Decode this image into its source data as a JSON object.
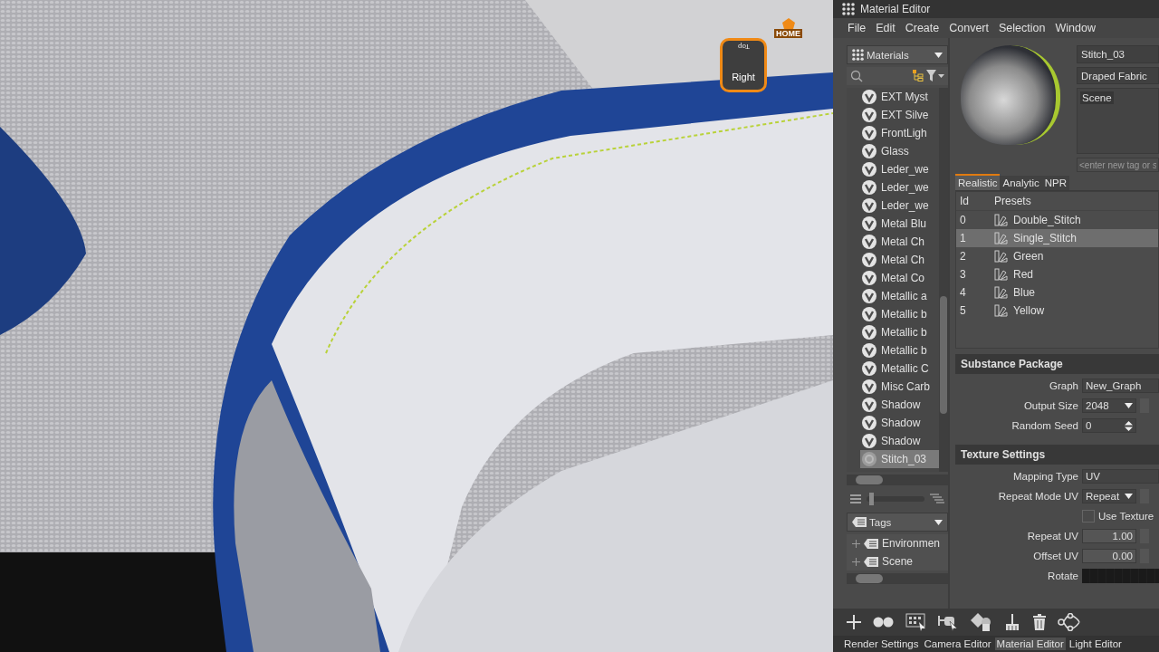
{
  "window": {
    "title": "Material Editor"
  },
  "menu": [
    "File",
    "Edit",
    "Create",
    "Convert",
    "Selection",
    "Window"
  ],
  "viewcube": {
    "top": "Top",
    "side": "Right",
    "home": "HOME"
  },
  "material_browser": {
    "dropdown": "Materials",
    "materials": [
      {
        "name": "EXT Myst",
        "selected": false
      },
      {
        "name": "EXT Silve",
        "selected": false
      },
      {
        "name": "FrontLigh",
        "selected": false
      },
      {
        "name": "Glass",
        "selected": false
      },
      {
        "name": "Leder_we",
        "selected": false
      },
      {
        "name": "Leder_we",
        "selected": false
      },
      {
        "name": "Leder_we",
        "selected": false
      },
      {
        "name": "Metal Blu",
        "selected": false
      },
      {
        "name": "Metal Ch",
        "selected": false
      },
      {
        "name": "Metal Ch",
        "selected": false
      },
      {
        "name": "Metal Co",
        "selected": false
      },
      {
        "name": "Metallic a",
        "selected": false
      },
      {
        "name": "Metallic b",
        "selected": false
      },
      {
        "name": "Metallic b",
        "selected": false
      },
      {
        "name": "Metallic b",
        "selected": false
      },
      {
        "name": "Metallic C",
        "selected": false
      },
      {
        "name": "Misc Carb",
        "selected": false
      },
      {
        "name": "Shadow",
        "selected": false
      },
      {
        "name": "Shadow",
        "selected": false
      },
      {
        "name": "Shadow",
        "selected": false
      },
      {
        "name": "Stitch_03",
        "selected": true
      }
    ]
  },
  "icon_size": {
    "level": 0.05
  },
  "tags_browser": {
    "dropdown": "Tags",
    "tags": [
      "Environmen",
      "Scene"
    ]
  },
  "material": {
    "name": "Stitch_03",
    "type": "Draped Fabric",
    "tags": [
      "Scene"
    ],
    "tag_placeholder": "<enter new tag or s"
  },
  "tabs": [
    {
      "label": "Realistic",
      "selected": true
    },
    {
      "label": "Analytic",
      "selected": false
    },
    {
      "label": "NPR",
      "selected": false
    }
  ],
  "presets": {
    "columns": [
      "Id",
      "Presets"
    ],
    "rows": [
      {
        "id": "0",
        "name": "Double_Stitch",
        "selected": false
      },
      {
        "id": "1",
        "name": "Single_Stitch",
        "selected": true
      },
      {
        "id": "2",
        "name": "Green",
        "selected": false
      },
      {
        "id": "3",
        "name": "Red",
        "selected": false
      },
      {
        "id": "4",
        "name": "Blue",
        "selected": false
      },
      {
        "id": "5",
        "name": "Yellow",
        "selected": false
      }
    ]
  },
  "sections": [
    {
      "title": "Substance Package",
      "fields": [
        {
          "kind": "text",
          "label": "Graph",
          "value": "New_Graph"
        },
        {
          "kind": "dropdown",
          "label": "Output Size",
          "value": "2048"
        },
        {
          "kind": "spinner",
          "label": "Random Seed",
          "value": "0"
        }
      ]
    },
    {
      "title": "Texture Settings",
      "fields": [
        {
          "kind": "text",
          "label": "Mapping Type",
          "value": "UV"
        },
        {
          "kind": "dropdown",
          "label": "Repeat Mode UV",
          "value": "Repeat"
        },
        {
          "kind": "checkbox",
          "label": "Use Texture",
          "checked": false
        },
        {
          "kind": "number",
          "label": "Repeat UV",
          "value": "1.00"
        },
        {
          "kind": "number",
          "label": "Offset UV",
          "value": "0.00"
        },
        {
          "kind": "ramp",
          "label": "Rotate"
        }
      ]
    }
  ],
  "bottom_tabs": [
    {
      "label": "Render Settings",
      "selected": false
    },
    {
      "label": "Camera Editor",
      "selected": false
    },
    {
      "label": "Material Editor",
      "selected": true
    },
    {
      "label": "Light Editor",
      "selected": false
    }
  ]
}
